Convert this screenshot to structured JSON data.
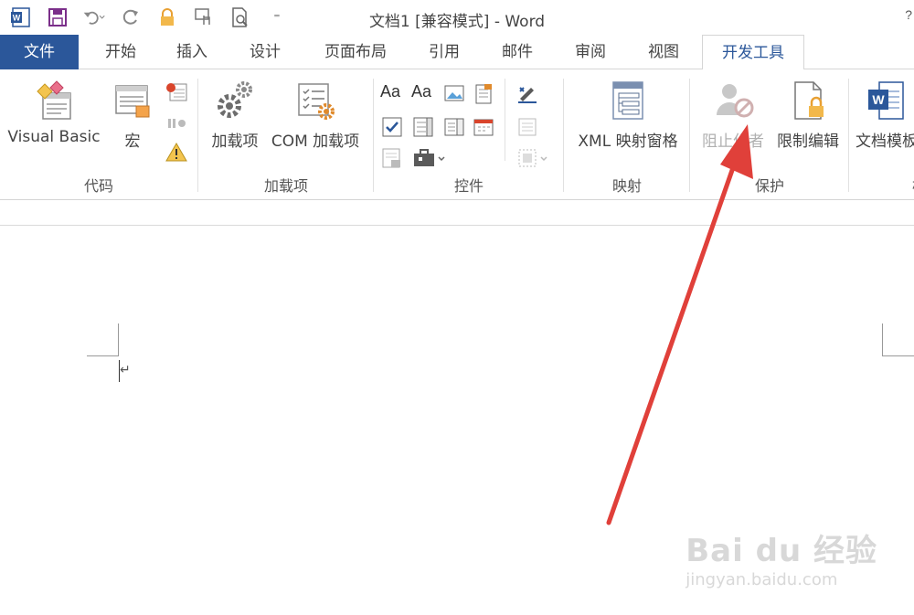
{
  "window": {
    "title": "文档1 [兼容模式] - Word",
    "help_glyph": "?"
  },
  "quick_access": {
    "items": [
      "word-logo",
      "save",
      "undo",
      "redo",
      "lock",
      "touch-mode",
      "print-preview",
      "customize"
    ],
    "customize_glyph": "⁼"
  },
  "tabs": [
    {
      "label": "文件"
    },
    {
      "label": "开始"
    },
    {
      "label": "插入"
    },
    {
      "label": "设计"
    },
    {
      "label": "页面布局"
    },
    {
      "label": "引用"
    },
    {
      "label": "邮件"
    },
    {
      "label": "审阅"
    },
    {
      "label": "视图"
    },
    {
      "label": "开发工具"
    }
  ],
  "active_tab": "开发工具",
  "ribbon": {
    "code": {
      "label": "代码",
      "visual_basic": "Visual Basic",
      "macro": "宏"
    },
    "addins": {
      "label": "加载项",
      "addins_btn": "加载项",
      "com_addins": "COM 加载项"
    },
    "controls": {
      "label": "控件"
    },
    "mapping": {
      "label": "映射",
      "xml_pane": "XML 映射窗格"
    },
    "protect": {
      "label": "保护",
      "block_authors": "阻止作者",
      "restrict_editing": "限制编辑"
    },
    "templates": {
      "doc_template": "文档模板",
      "partial_label": "模"
    }
  },
  "watermark": {
    "brand": "Bai du 经验",
    "url": "jingyan.baidu.com"
  },
  "colors": {
    "accent": "#2b579a",
    "arrow": "#e0403a"
  }
}
